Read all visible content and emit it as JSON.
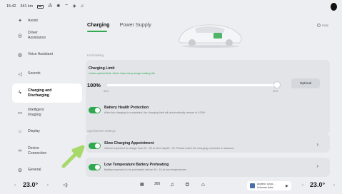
{
  "status_bar": {
    "time": "15:42",
    "range": "341 km",
    "icons": [
      "battery-icon",
      "signal-icon",
      "bluetooth-icon",
      "wifi-icon",
      "location-icon",
      "bell-icon"
    ]
  },
  "sidebar": {
    "items": [
      {
        "label": "Assist",
        "icon": "assist-icon"
      },
      {
        "label": "Driver\nAssistance",
        "icon": "steering-icon"
      },
      {
        "label": "Voice Assistant",
        "icon": "voice-icon"
      },
      {
        "label": "Sounds",
        "icon": "speaker-icon"
      },
      {
        "label": "Charging and\nDischarging",
        "icon": "charging-icon",
        "active": true
      },
      {
        "label": "Intelligent\nImaging",
        "icon": "camera-icon"
      },
      {
        "label": "Display",
        "icon": "sun-icon"
      },
      {
        "label": "Device\nConnection",
        "icon": "link-icon"
      },
      {
        "label": "General",
        "icon": "gear-icon"
      }
    ]
  },
  "main": {
    "tabs": [
      {
        "label": "Charging",
        "active": true
      },
      {
        "label": "Power Supply",
        "active": false
      }
    ],
    "help_label": "Help",
    "limit_section_label": "Limit Setting",
    "charging_limit": {
      "title": "Charging Limit",
      "subtitle": "Under optimal limit, which helps keep longer battery life",
      "value": "100%",
      "value_fraction": 1.0,
      "min_tick": "50%",
      "max_tick": "90%",
      "optimal_label": "Optimal"
    },
    "battery_health": {
      "title": "Battery Health Protection",
      "subtitle": "After this charging is completed, the charging limit will automatically restore to 100%",
      "enabled": true
    },
    "appointment_section_label": "Appointment Settings",
    "slow_charging": {
      "title": "Slow Charging Appointment",
      "subtitle": "Vehicle expected to charge from 22 : 00 to Next day06 : 00. Please insert the charging connector in advance",
      "enabled": true
    },
    "preheating": {
      "title": "Low Temperature Battery Preheating",
      "subtitle": "Battery expected to be preheated before 08 : 15 at low temperatures",
      "enabled": true
    }
  },
  "dock": {
    "left_temp": "23.0°",
    "right_temp": "23.0°",
    "center_icons": [
      "apps-icon",
      "camera-360-icon",
      "music-icon",
      "car-icon",
      "home-icon"
    ],
    "media_title": "Anytime, Anyw…",
    "media_sub": "Unknown Artist"
  },
  "colors": {
    "accent": "#2fa84f",
    "background": "#eceef1",
    "card": "#e2e4e8"
  }
}
